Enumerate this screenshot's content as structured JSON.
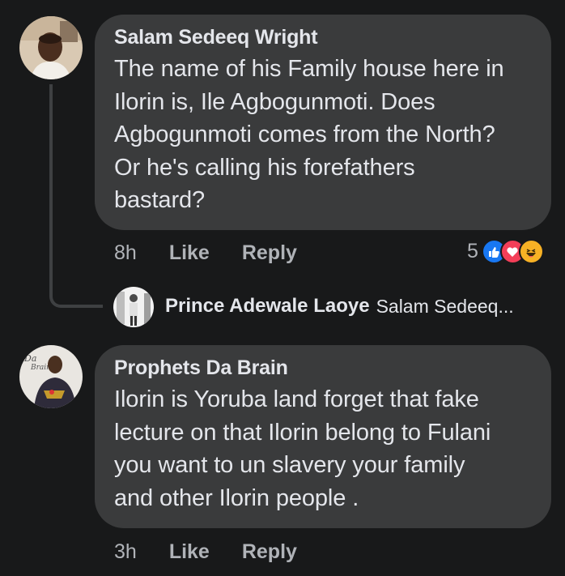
{
  "comments": [
    {
      "author": "Salam Sedeeq Wright",
      "lines": [
        "The name of his Family house here in",
        "Ilorin is, Ile Agbogunmoti. Does",
        "Agbogunmoti comes from the North?",
        "Or he's calling his forefathers",
        "bastard?"
      ],
      "time": "8h",
      "like_label": "Like",
      "reply_label": "Reply",
      "reaction_count": "5",
      "reactions": [
        "like-icon",
        "love-icon",
        "haha-icon"
      ]
    },
    {
      "author": "Prophets Da Brain",
      "lines": [
        "Ilorin is Yoruba land forget that fake",
        "lecture on that Ilorin belong to Fulani",
        "you want to un slavery your family",
        "and other Ilorin people ."
      ],
      "time": "3h",
      "like_label": "Like",
      "reply_label": "Reply"
    }
  ],
  "reply_preview": {
    "name": "Prince Adewale Laoye",
    "snippet": "Salam Sedeeq..."
  },
  "colors": {
    "background": "#18191a",
    "bubble": "#3a3b3c",
    "text": "#e4e6eb",
    "muted": "#b0b3b8",
    "like_blue": "#1877f2",
    "love_red": "#f33e58",
    "haha_yellow": "#f7b125"
  }
}
